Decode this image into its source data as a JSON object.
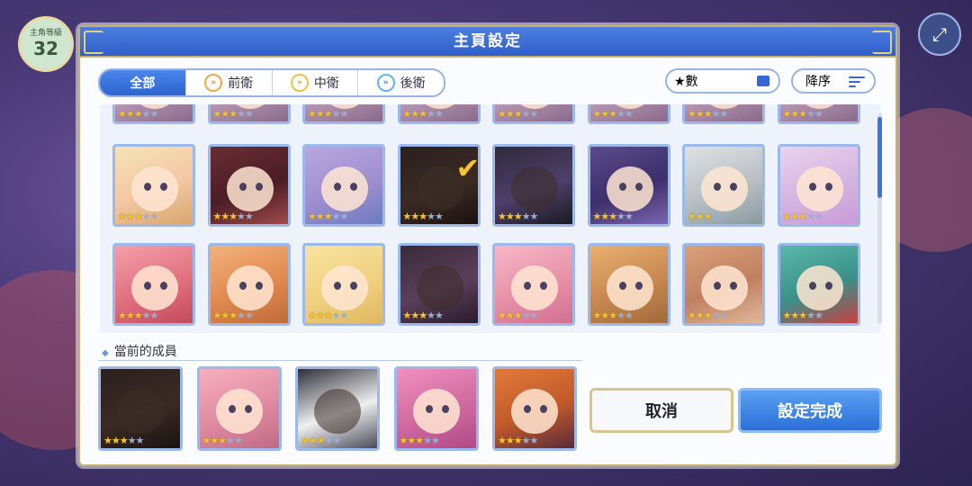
{
  "level": {
    "label": "主角等級",
    "value": "32"
  },
  "dialog": {
    "title": "主頁設定"
  },
  "tabs": [
    {
      "label": "全部",
      "active": true
    },
    {
      "label": "前衛",
      "icon": "front-role-icon"
    },
    {
      "label": "中衛",
      "icon": "middle-role-icon"
    },
    {
      "label": "後衛",
      "icon": "back-role-icon"
    }
  ],
  "sort": {
    "filter_label": "★數",
    "order_label": "降序"
  },
  "roster": {
    "partial_row_stars": [
      3,
      3,
      3,
      3,
      3,
      3,
      3,
      3
    ],
    "rows": [
      [
        {
          "name": "character-card",
          "stars": 3,
          "colors": [
            "#f7e3b5",
            "#f2c7a3",
            "#d9a56b"
          ]
        },
        {
          "name": "character-card",
          "stars": 3,
          "colors": [
            "#6a2d35",
            "#4a1d25",
            "#a04a4a"
          ]
        },
        {
          "name": "character-card",
          "stars": 3,
          "colors": [
            "#b8a7e0",
            "#9f8fd0",
            "#6d7bc0"
          ]
        },
        {
          "name": "character-card",
          "stars": 3,
          "colors": [
            "#2a2020",
            "#3b2a22",
            "#1a1212"
          ],
          "selected": true
        },
        {
          "name": "character-card",
          "stars": 3,
          "colors": [
            "#2f2a3a",
            "#4e3f6a",
            "#1a1a24"
          ]
        },
        {
          "name": "character-card",
          "stars": 3,
          "colors": [
            "#5a4a8a",
            "#3d2f6a",
            "#7b66b0"
          ]
        },
        {
          "name": "character-card",
          "stars": 3,
          "colors": [
            "#dfe2e4",
            "#b8c0c4",
            "#8a9aa0"
          ]
        },
        {
          "name": "character-card",
          "stars": 3,
          "colors": [
            "#e9d3ef",
            "#d4b4e0",
            "#c99bd8"
          ]
        }
      ],
      [
        {
          "name": "character-card",
          "stars": 3,
          "colors": [
            "#f4a0a8",
            "#e07080",
            "#c44a5a"
          ]
        },
        {
          "name": "character-card",
          "stars": 3,
          "colors": [
            "#f3b27a",
            "#e08a50",
            "#c06a3a"
          ]
        },
        {
          "name": "character-card",
          "stars": 3,
          "colors": [
            "#f8e3a0",
            "#f0d080",
            "#e0b860"
          ]
        },
        {
          "name": "character-card",
          "stars": 3,
          "colors": [
            "#3a2a3a",
            "#5a3f5a",
            "#2a1a2a"
          ]
        },
        {
          "name": "character-card",
          "stars": 3,
          "colors": [
            "#f6b8c8",
            "#e890a8",
            "#d07090"
          ]
        },
        {
          "name": "character-card",
          "stars": 3,
          "colors": [
            "#e9b070",
            "#c88850",
            "#a06a3a"
          ]
        },
        {
          "name": "character-card",
          "stars": 3,
          "colors": [
            "#d9a07a",
            "#c08060",
            "#e0b89a"
          ]
        },
        {
          "name": "character-card",
          "stars": 3,
          "colors": [
            "#5ab8a8",
            "#3a9088",
            "#c84040"
          ]
        }
      ]
    ]
  },
  "current_members": {
    "label": "當前的成員",
    "cards": [
      {
        "stars": 3,
        "colors": [
          "#2a2020",
          "#3b2a22",
          "#1a1212"
        ]
      },
      {
        "stars": 3,
        "colors": [
          "#f6b0c0",
          "#e08aa0",
          "#c06a88"
        ]
      },
      {
        "stars": 3,
        "colors": [
          "#2f2f3a",
          "#f0f0f0",
          "#4a4a5a"
        ]
      },
      {
        "stars": 3,
        "colors": [
          "#f090c0",
          "#d06aa0",
          "#b04a88"
        ]
      },
      {
        "stars": 3,
        "colors": [
          "#e07a3a",
          "#c05a2a",
          "#5a2a3a"
        ]
      }
    ]
  },
  "buttons": {
    "cancel": "取消",
    "confirm": "設定完成"
  },
  "colors": {
    "accent": "#2f5fc9",
    "gold": "#c9b06b",
    "star": "#f4c430"
  }
}
